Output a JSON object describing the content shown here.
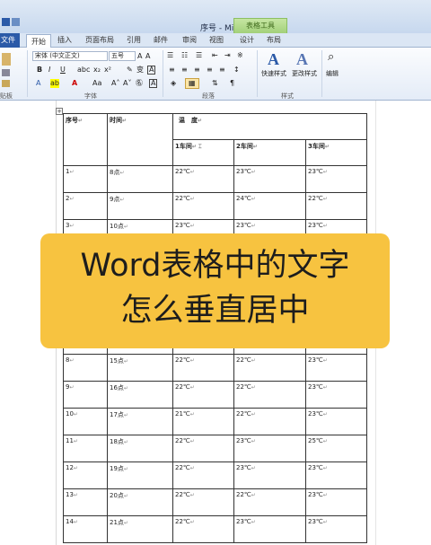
{
  "window": {
    "title": "序号 - Microsoft Word",
    "context_tab": "表格工具"
  },
  "tabs": [
    {
      "label": "文件"
    },
    {
      "label": "开始"
    },
    {
      "label": "插入"
    },
    {
      "label": "页面布局"
    },
    {
      "label": "引用"
    },
    {
      "label": "邮件"
    },
    {
      "label": "审阅"
    },
    {
      "label": "视图"
    },
    {
      "label": "设计"
    },
    {
      "label": "布局"
    }
  ],
  "ribbon": {
    "font_name": "宋体 (中文正文)",
    "font_size": "五号",
    "font_group": "字体",
    "paragraph_group": "段落",
    "style_group": "样式",
    "clipboard_group": "贴板",
    "quick_styles": "快速样式",
    "change_styles": "更改样式",
    "edit": "编辑",
    "bold": "B",
    "italic": "I",
    "underline": "U",
    "phonetic": "变",
    "char_border": "A"
  },
  "table": {
    "header": {
      "seq": "序号",
      "time": "时间",
      "temp": "温　度",
      "workshops": [
        "1车间",
        "2车间",
        "3车间"
      ]
    },
    "rows": [
      {
        "seq": "1",
        "time": "8点",
        "t": [
          "22℃",
          "23℃",
          "23℃"
        ]
      },
      {
        "seq": "2",
        "time": "9点",
        "t": [
          "22℃",
          "24℃",
          "22℃"
        ]
      },
      {
        "seq": "3",
        "time": "10点",
        "t": [
          "23℃",
          "23℃",
          "23℃"
        ]
      },
      {
        "seq": "",
        "time": "",
        "t": [
          "",
          "",
          ""
        ]
      },
      {
        "seq": "",
        "time": "",
        "t": [
          "",
          "",
          ""
        ]
      },
      {
        "seq": "",
        "time": "",
        "t": [
          "",
          "",
          ""
        ]
      },
      {
        "seq": "",
        "time": "",
        "t": [
          "",
          "",
          ""
        ]
      },
      {
        "seq": "8",
        "time": "15点",
        "t": [
          "22℃",
          "22℃",
          "23℃"
        ]
      },
      {
        "seq": "9",
        "time": "16点",
        "t": [
          "22℃",
          "22℃",
          "23℃"
        ]
      },
      {
        "seq": "10",
        "time": "17点",
        "t": [
          "21℃",
          "22℃",
          "23℃"
        ]
      },
      {
        "seq": "11",
        "time": "18点",
        "t": [
          "22℃",
          "23℃",
          "25℃"
        ]
      },
      {
        "seq": "12",
        "time": "19点",
        "t": [
          "22℃",
          "23℃",
          "23℃"
        ]
      },
      {
        "seq": "13",
        "time": "20点",
        "t": [
          "22℃",
          "22℃",
          "23℃"
        ]
      },
      {
        "seq": "14",
        "time": "21点",
        "t": [
          "22℃",
          "23℃",
          "23℃"
        ]
      }
    ]
  },
  "banner": {
    "line1": "Word表格中的文字",
    "line2": "怎么垂直居中"
  },
  "colors": {
    "banner": "#f7c340",
    "file_tab": "#2b5aa8",
    "context_tab": "#a2d07a"
  }
}
